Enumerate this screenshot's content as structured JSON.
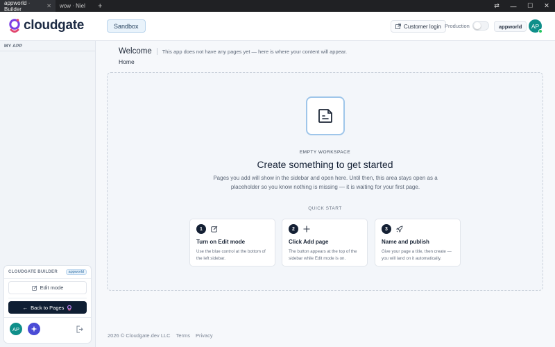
{
  "browser": {
    "tabs": [
      {
        "label": "appworld · Builder",
        "active": true
      },
      {
        "label": "wow · Niel",
        "active": false
      }
    ]
  },
  "header": {
    "logo_text": "cloudgate",
    "env_label": "Sandbox",
    "customer_login": "Customer login",
    "production_label": "Production",
    "production_on": false,
    "app_chip": "appworld",
    "avatar_initials": "AP"
  },
  "sidebar": {
    "section_label": "MY APP",
    "builder": {
      "title": "CLOUDGATE BUILDER",
      "chip": "appworld",
      "edit_mode": "Edit mode",
      "back_to_pages": "Back to Pages",
      "avatar_initials": "AP"
    }
  },
  "main": {
    "title": "Welcome",
    "subtitle": "This app does not have any pages yet — here is where your content will appear.",
    "breadcrumb": "Home",
    "empty": {
      "eyebrow": "EMPTY WORKSPACE",
      "headline": "Create something to get started",
      "description": "Pages you add will show in the sidebar and open here. Until then, this area stays open as a placeholder so you know nothing is missing — it is waiting for your first page.",
      "quick_start": "QUICK START",
      "steps": [
        {
          "num": "1",
          "icon": "edit-icon",
          "title": "Turn on Edit mode",
          "desc": "Use the blue control at the bottom of the left sidebar."
        },
        {
          "num": "2",
          "icon": "plus-icon",
          "title": "Click Add page",
          "desc": "The button appears at the top of the sidebar while Edit mode is on."
        },
        {
          "num": "3",
          "icon": "rocket-icon",
          "title": "Name and publish",
          "desc": "Give your page a title, then create — you will land on it automatically."
        }
      ]
    }
  },
  "footer": {
    "copyright": "2026 © Cloudgate.dev LLC",
    "terms": "Terms",
    "privacy": "Privacy"
  },
  "colors": {
    "brand_purple": "#7b3fe4",
    "navy": "#0f1e33",
    "teal_avatar": "#0f8f8a",
    "accent_blue": "#9fc6ea"
  }
}
